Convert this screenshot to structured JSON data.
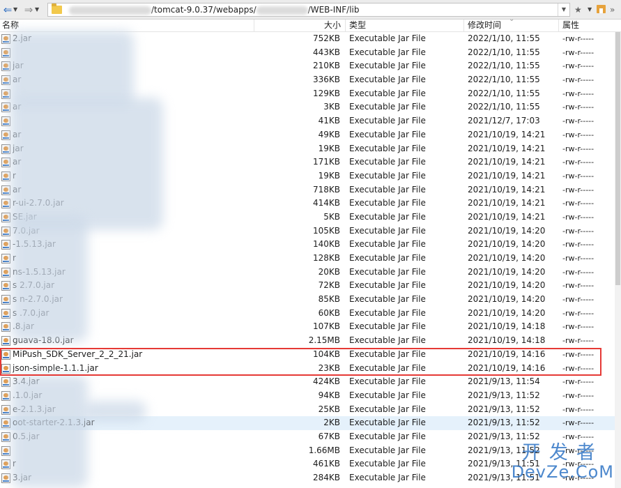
{
  "address_bar": {
    "path_middle": "/tomcat-9.0.37/webapps/",
    "path_end": "/WEB-INF/lib",
    "more_glyph": "»",
    "star_glyph": "★"
  },
  "columns": {
    "name": "名称",
    "size": "大小",
    "type": "类型",
    "date": "修改时间",
    "attr": "属性"
  },
  "rows": [
    {
      "name": "2.jar",
      "size": "752KB",
      "type": "Executable Jar File",
      "date": "2022/1/10, 11:55",
      "attr": "-rw-r-----"
    },
    {
      "name": "",
      "size": "443KB",
      "type": "Executable Jar File",
      "date": "2022/1/10, 11:55",
      "attr": "-rw-r-----"
    },
    {
      "name": "jar",
      "size": "210KB",
      "type": "Executable Jar File",
      "date": "2022/1/10, 11:55",
      "attr": "-rw-r-----"
    },
    {
      "name": "ar",
      "size": "336KB",
      "type": "Executable Jar File",
      "date": "2022/1/10, 11:55",
      "attr": "-rw-r-----"
    },
    {
      "name": "",
      "size": "129KB",
      "type": "Executable Jar File",
      "date": "2022/1/10, 11:55",
      "attr": "-rw-r-----"
    },
    {
      "name": "ar",
      "size": "3KB",
      "type": "Executable Jar File",
      "date": "2022/1/10, 11:55",
      "attr": "-rw-r-----"
    },
    {
      "name": "",
      "size": "41KB",
      "type": "Executable Jar File",
      "date": "2021/12/7, 17:03",
      "attr": "-rw-r-----"
    },
    {
      "name": "ar",
      "size": "49KB",
      "type": "Executable Jar File",
      "date": "2021/10/19, 14:21",
      "attr": "-rw-r-----"
    },
    {
      "name": "jar",
      "size": "19KB",
      "type": "Executable Jar File",
      "date": "2021/10/19, 14:21",
      "attr": "-rw-r-----"
    },
    {
      "name": "ar",
      "size": "171KB",
      "type": "Executable Jar File",
      "date": "2021/10/19, 14:21",
      "attr": "-rw-r-----"
    },
    {
      "name": "r",
      "size": "19KB",
      "type": "Executable Jar File",
      "date": "2021/10/19, 14:21",
      "attr": "-rw-r-----"
    },
    {
      "name": "ar",
      "size": "718KB",
      "type": "Executable Jar File",
      "date": "2021/10/19, 14:21",
      "attr": "-rw-r-----"
    },
    {
      "name": "r-ui-2.7.0.jar",
      "size": "414KB",
      "type": "Executable Jar File",
      "date": "2021/10/19, 14:21",
      "attr": "-rw-r-----"
    },
    {
      "name": "SE.jar",
      "size": "5KB",
      "type": "Executable Jar File",
      "date": "2021/10/19, 14:21",
      "attr": "-rw-r-----"
    },
    {
      "name": "7.0.jar",
      "size": "105KB",
      "type": "Executable Jar File",
      "date": "2021/10/19, 14:20",
      "attr": "-rw-r-----"
    },
    {
      "name": "-1.5.13.jar",
      "size": "140KB",
      "type": "Executable Jar File",
      "date": "2021/10/19, 14:20",
      "attr": "-rw-r-----"
    },
    {
      "name": "r",
      "size": "128KB",
      "type": "Executable Jar File",
      "date": "2021/10/19, 14:20",
      "attr": "-rw-r-----"
    },
    {
      "name": "ns-1.5.13.jar",
      "size": "20KB",
      "type": "Executable Jar File",
      "date": "2021/10/19, 14:20",
      "attr": "-rw-r-----"
    },
    {
      "name": "s 2.7.0.jar",
      "size": "72KB",
      "type": "Executable Jar File",
      "date": "2021/10/19, 14:20",
      "attr": "-rw-r-----"
    },
    {
      "name": "s n-2.7.0.jar",
      "size": "85KB",
      "type": "Executable Jar File",
      "date": "2021/10/19, 14:20",
      "attr": "-rw-r-----"
    },
    {
      "name": "s .7.0.jar",
      "size": "60KB",
      "type": "Executable Jar File",
      "date": "2021/10/19, 14:20",
      "attr": "-rw-r-----"
    },
    {
      "name": ".8.jar",
      "size": "107KB",
      "type": "Executable Jar File",
      "date": "2021/10/19, 14:18",
      "attr": "-rw-r-----"
    },
    {
      "name": "guava-18.0.jar",
      "size": "2.15MB",
      "type": "Executable Jar File",
      "date": "2021/10/19, 14:18",
      "attr": "-rw-r-----"
    },
    {
      "name": "MiPush_SDK_Server_2_2_21.jar",
      "size": "104KB",
      "type": "Executable Jar File",
      "date": "2021/10/19, 14:16",
      "attr": "-rw-r-----"
    },
    {
      "name": "json-simple-1.1.1.jar",
      "size": "23KB",
      "type": "Executable Jar File",
      "date": "2021/10/19, 14:16",
      "attr": "-rw-r-----"
    },
    {
      "name": "3.4.jar",
      "size": "424KB",
      "type": "Executable Jar File",
      "date": "2021/9/13, 11:54",
      "attr": "-rw-r-----"
    },
    {
      "name": ".1.0.jar",
      "size": "94KB",
      "type": "Executable Jar File",
      "date": "2021/9/13, 11:52",
      "attr": "-rw-r-----"
    },
    {
      "name": "e-2.1.3.jar",
      "size": "25KB",
      "type": "Executable Jar File",
      "date": "2021/9/13, 11:52",
      "attr": "-rw-r-----"
    },
    {
      "name": "oot-starter-2.1.3.jar",
      "size": "2KB",
      "type": "Executable Jar File",
      "date": "2021/9/13, 11:52",
      "attr": "-rw-r-----"
    },
    {
      "name": "0.5.jar",
      "size": "67KB",
      "type": "Executable Jar File",
      "date": "2021/9/13, 11:52",
      "attr": "-rw-r-----"
    },
    {
      "name": "",
      "size": "1.66MB",
      "type": "Executable Jar File",
      "date": "2021/9/13, 11:52",
      "attr": "-rw-r-----"
    },
    {
      "name": "r",
      "size": "461KB",
      "type": "Executable Jar File",
      "date": "2021/9/13, 11:51",
      "attr": "-rw-r-----"
    },
    {
      "name": "3.jar",
      "size": "284KB",
      "type": "Executable Jar File",
      "date": "2021/9/13, 11:51",
      "attr": "-rw-r-----"
    }
  ],
  "selected_row": 28,
  "watermark": {
    "top": "开发者",
    "bottom": "DevZe.CoM"
  },
  "colors": {
    "highlight": "#e53935",
    "selection": "#e5f1fb",
    "watermark": "#2e74c5"
  }
}
